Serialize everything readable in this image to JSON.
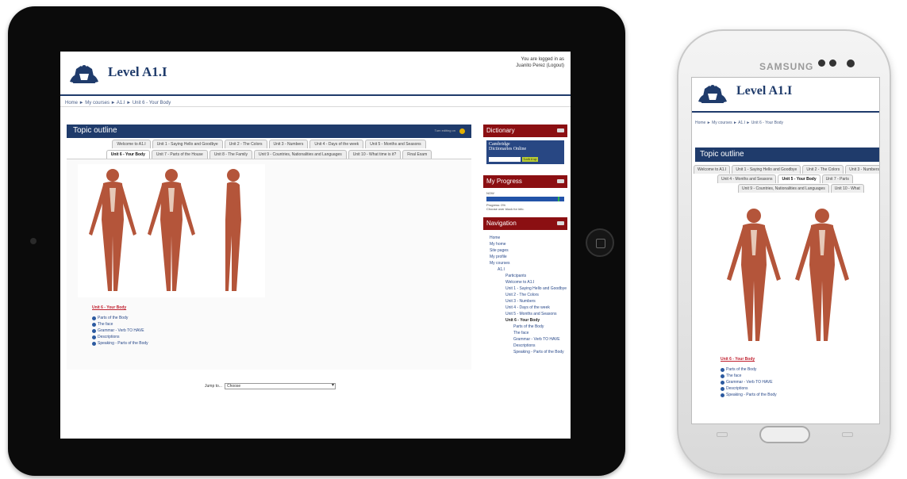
{
  "site": {
    "title": "Level A1.I",
    "login_line1": "You are logged in as",
    "login_line2": "Juanito Perez (Logout)",
    "breadcrumb": "Home ► My courses ► A1.I ► Unit 6 - Your Body"
  },
  "topic": {
    "title": "Topic outline",
    "edit_label": "Turn editing on",
    "tabs_row1": [
      "Welcome to A1.I",
      "Unit 1 - Saying Hello and Goodbye",
      "Unit 2 - The Colors",
      "Unit 3 - Numbers",
      "Unit 4 - Days of the week",
      "Unit 5 - Months and Seasons"
    ],
    "tabs_row2": [
      "Unit 6 - Your Body",
      "Unit 7 - Parts of the House",
      "Unit 8 - The Family",
      "Unit 9 - Countries, Nationalities and Languages",
      "Unit 10 - What time is it?",
      "Final Exam"
    ],
    "active_tab": "Unit 6 - Your Body"
  },
  "section": {
    "title": "Unit 6 - Your Body",
    "activities": [
      "Parts of the Body",
      "The face",
      "Grammar - Verb TO HAVE",
      "Descriptions",
      "Speaking - Parts of the Body"
    ]
  },
  "jump": {
    "label": "Jump to...",
    "value": "Choose"
  },
  "blocks": {
    "dictionary": {
      "title": "Dictionary",
      "logo_line1": "Cambridge",
      "logo_line2": "Dictionaries Online",
      "search_button": "Look it up"
    },
    "progress": {
      "title": "My Progress",
      "now_label": "NOW",
      "progress_text": "Progress: 0%",
      "hint_text": "Choose over block for info."
    },
    "navigation": {
      "title": "Navigation",
      "items": [
        {
          "label": "Home",
          "level": 1
        },
        {
          "label": "My home",
          "level": 1
        },
        {
          "label": "Site pages",
          "level": 1
        },
        {
          "label": "My profile",
          "level": 1
        },
        {
          "label": "My courses",
          "level": 1
        },
        {
          "label": "A1.I",
          "level": 2
        },
        {
          "label": "Participants",
          "level": 3
        },
        {
          "label": "Welcome to A1.I",
          "level": 3
        },
        {
          "label": "Unit 1 - Saying Hello and Goodbye",
          "level": 3
        },
        {
          "label": "Unit 2 - The Colors",
          "level": 3
        },
        {
          "label": "Unit 3 - Numbers",
          "level": 3
        },
        {
          "label": "Unit 4 - Days of the week",
          "level": 3
        },
        {
          "label": "Unit 5 - Months and Seasons",
          "level": 3
        },
        {
          "label": "Unit 6 - Your Body",
          "level": 3,
          "bold": true
        },
        {
          "label": "Parts of the Body",
          "level": 4
        },
        {
          "label": "The face",
          "level": 4
        },
        {
          "label": "Grammar - Verb TO HAVE",
          "level": 4
        },
        {
          "label": "Descriptions",
          "level": 4
        },
        {
          "label": "Speaking - Parts of the Body",
          "level": 4
        }
      ]
    }
  },
  "phone": {
    "brand": "SAMSUNG",
    "tabs_row1": [
      "Welcome to A1.I",
      "Unit 1 - Saying Hello and Goodbye",
      "Unit 2 - The Colors",
      "Unit 3 - Numbers"
    ],
    "tabs_row2": [
      "Unit 4 - Months and Seasons",
      "Unit 5 - Your Body",
      "Unit 7 - Parts"
    ],
    "tabs_row3": [
      "Unit 9 - Countries, Nationalities and Languages",
      "Unit 10 - What"
    ],
    "active_tab": "Unit 5 - Your Body"
  },
  "colors": {
    "brand_blue": "#1f3b6b",
    "block_red": "#8b0f12",
    "link_blue": "#2a4a8a",
    "section_red": "#c0202f"
  }
}
